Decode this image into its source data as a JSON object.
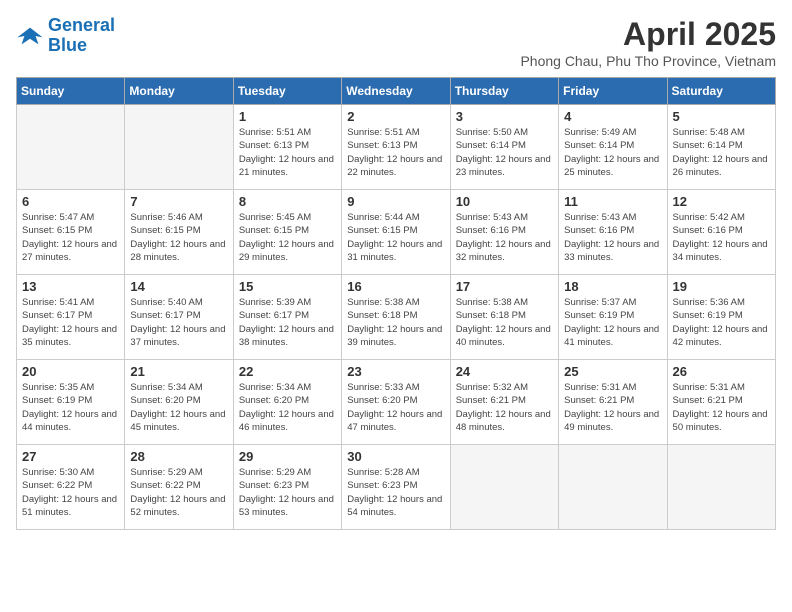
{
  "header": {
    "logo_line1": "General",
    "logo_line2": "Blue",
    "title": "April 2025",
    "subtitle": "Phong Chau, Phu Tho Province, Vietnam"
  },
  "days_of_week": [
    "Sunday",
    "Monday",
    "Tuesday",
    "Wednesday",
    "Thursday",
    "Friday",
    "Saturday"
  ],
  "weeks": [
    [
      {
        "day": "",
        "info": ""
      },
      {
        "day": "",
        "info": ""
      },
      {
        "day": "1",
        "info": "Sunrise: 5:51 AM\nSunset: 6:13 PM\nDaylight: 12 hours and 21 minutes."
      },
      {
        "day": "2",
        "info": "Sunrise: 5:51 AM\nSunset: 6:13 PM\nDaylight: 12 hours and 22 minutes."
      },
      {
        "day": "3",
        "info": "Sunrise: 5:50 AM\nSunset: 6:14 PM\nDaylight: 12 hours and 23 minutes."
      },
      {
        "day": "4",
        "info": "Sunrise: 5:49 AM\nSunset: 6:14 PM\nDaylight: 12 hours and 25 minutes."
      },
      {
        "day": "5",
        "info": "Sunrise: 5:48 AM\nSunset: 6:14 PM\nDaylight: 12 hours and 26 minutes."
      }
    ],
    [
      {
        "day": "6",
        "info": "Sunrise: 5:47 AM\nSunset: 6:15 PM\nDaylight: 12 hours and 27 minutes."
      },
      {
        "day": "7",
        "info": "Sunrise: 5:46 AM\nSunset: 6:15 PM\nDaylight: 12 hours and 28 minutes."
      },
      {
        "day": "8",
        "info": "Sunrise: 5:45 AM\nSunset: 6:15 PM\nDaylight: 12 hours and 29 minutes."
      },
      {
        "day": "9",
        "info": "Sunrise: 5:44 AM\nSunset: 6:15 PM\nDaylight: 12 hours and 31 minutes."
      },
      {
        "day": "10",
        "info": "Sunrise: 5:43 AM\nSunset: 6:16 PM\nDaylight: 12 hours and 32 minutes."
      },
      {
        "day": "11",
        "info": "Sunrise: 5:43 AM\nSunset: 6:16 PM\nDaylight: 12 hours and 33 minutes."
      },
      {
        "day": "12",
        "info": "Sunrise: 5:42 AM\nSunset: 6:16 PM\nDaylight: 12 hours and 34 minutes."
      }
    ],
    [
      {
        "day": "13",
        "info": "Sunrise: 5:41 AM\nSunset: 6:17 PM\nDaylight: 12 hours and 35 minutes."
      },
      {
        "day": "14",
        "info": "Sunrise: 5:40 AM\nSunset: 6:17 PM\nDaylight: 12 hours and 37 minutes."
      },
      {
        "day": "15",
        "info": "Sunrise: 5:39 AM\nSunset: 6:17 PM\nDaylight: 12 hours and 38 minutes."
      },
      {
        "day": "16",
        "info": "Sunrise: 5:38 AM\nSunset: 6:18 PM\nDaylight: 12 hours and 39 minutes."
      },
      {
        "day": "17",
        "info": "Sunrise: 5:38 AM\nSunset: 6:18 PM\nDaylight: 12 hours and 40 minutes."
      },
      {
        "day": "18",
        "info": "Sunrise: 5:37 AM\nSunset: 6:19 PM\nDaylight: 12 hours and 41 minutes."
      },
      {
        "day": "19",
        "info": "Sunrise: 5:36 AM\nSunset: 6:19 PM\nDaylight: 12 hours and 42 minutes."
      }
    ],
    [
      {
        "day": "20",
        "info": "Sunrise: 5:35 AM\nSunset: 6:19 PM\nDaylight: 12 hours and 44 minutes."
      },
      {
        "day": "21",
        "info": "Sunrise: 5:34 AM\nSunset: 6:20 PM\nDaylight: 12 hours and 45 minutes."
      },
      {
        "day": "22",
        "info": "Sunrise: 5:34 AM\nSunset: 6:20 PM\nDaylight: 12 hours and 46 minutes."
      },
      {
        "day": "23",
        "info": "Sunrise: 5:33 AM\nSunset: 6:20 PM\nDaylight: 12 hours and 47 minutes."
      },
      {
        "day": "24",
        "info": "Sunrise: 5:32 AM\nSunset: 6:21 PM\nDaylight: 12 hours and 48 minutes."
      },
      {
        "day": "25",
        "info": "Sunrise: 5:31 AM\nSunset: 6:21 PM\nDaylight: 12 hours and 49 minutes."
      },
      {
        "day": "26",
        "info": "Sunrise: 5:31 AM\nSunset: 6:21 PM\nDaylight: 12 hours and 50 minutes."
      }
    ],
    [
      {
        "day": "27",
        "info": "Sunrise: 5:30 AM\nSunset: 6:22 PM\nDaylight: 12 hours and 51 minutes."
      },
      {
        "day": "28",
        "info": "Sunrise: 5:29 AM\nSunset: 6:22 PM\nDaylight: 12 hours and 52 minutes."
      },
      {
        "day": "29",
        "info": "Sunrise: 5:29 AM\nSunset: 6:23 PM\nDaylight: 12 hours and 53 minutes."
      },
      {
        "day": "30",
        "info": "Sunrise: 5:28 AM\nSunset: 6:23 PM\nDaylight: 12 hours and 54 minutes."
      },
      {
        "day": "",
        "info": ""
      },
      {
        "day": "",
        "info": ""
      },
      {
        "day": "",
        "info": ""
      }
    ]
  ]
}
